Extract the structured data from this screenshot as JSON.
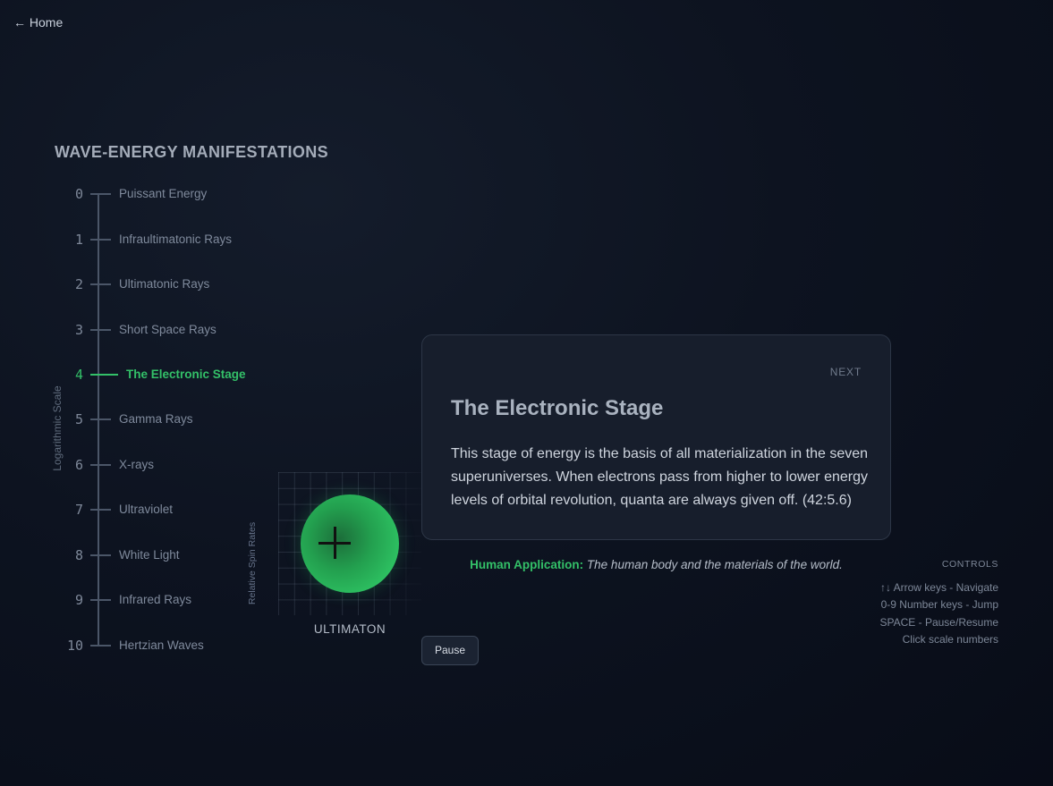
{
  "nav": {
    "home_label": "← Home"
  },
  "section_title": "WAVE-ENERGY MANIFESTATIONS",
  "scale_axis_label": "Logarithmic Scale",
  "scale": [
    {
      "num": "0",
      "label": "Puissant Energy"
    },
    {
      "num": "1",
      "label": "Infraultimatonic Rays"
    },
    {
      "num": "2",
      "label": "Ultimatonic Rays"
    },
    {
      "num": "3",
      "label": "Short Space Rays"
    },
    {
      "num": "4",
      "label": "The Electronic Stage"
    },
    {
      "num": "5",
      "label": "Gamma Rays"
    },
    {
      "num": "6",
      "label": "X-rays"
    },
    {
      "num": "7",
      "label": "Ultraviolet"
    },
    {
      "num": "8",
      "label": "White Light"
    },
    {
      "num": "9",
      "label": "Infrared Rays"
    },
    {
      "num": "10",
      "label": "Hertzian Waves"
    }
  ],
  "active_index": 4,
  "visualization": {
    "y_label": "Relative Spin Rates",
    "name": "ULTIMATON",
    "orb_color": "#2dc061"
  },
  "card": {
    "next_label": "NEXT",
    "title": "The Electronic Stage",
    "body": "This stage of energy is the basis of all materialization in the seven superuniverses. When electrons pass from higher to lower energy levels of orbital revolution, quanta are always given off. (42:5.6)"
  },
  "human_application": {
    "label": "Human Application:",
    "text": "The human body and the materials of the world."
  },
  "pause_label": "Pause",
  "controls": {
    "title": "CONTROLS",
    "lines": [
      "↑↓ Arrow keys - Navigate",
      "0-9 Number keys - Jump",
      "SPACE - Pause/Resume",
      "Click scale numbers"
    ]
  },
  "colors": {
    "accent": "#33c068",
    "background": "#0d1320",
    "card": "#171e2c"
  }
}
